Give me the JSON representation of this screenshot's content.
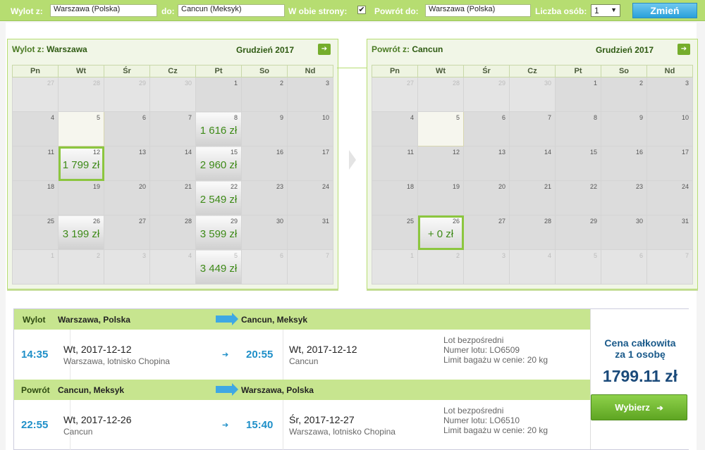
{
  "search": {
    "from_label": "Wylot z:",
    "from_value": "Warszawa (Polska)",
    "to_label": "do:",
    "to_value": "Cancun (Meksyk)",
    "roundtrip_label": "W obie strony:",
    "roundtrip_checked": "✔",
    "return_label": "Powrót do:",
    "return_value": "Warszawa (Polska)",
    "persons_label": "Liczba osób:",
    "persons_value": "1",
    "change_button": "Zmień"
  },
  "outbound_calendar": {
    "title_prefix": "Wylot z:",
    "title_city": "Warszawa",
    "month": "Grudzień 2017",
    "weekdays": [
      "Pn",
      "Wt",
      "Śr",
      "Cz",
      "Pt",
      "So",
      "Nd"
    ],
    "weeks": [
      [
        {
          "d": "27",
          "o": 1
        },
        {
          "d": "28",
          "o": 1
        },
        {
          "d": "29",
          "o": 1
        },
        {
          "d": "30",
          "o": 1
        },
        {
          "d": "1"
        },
        {
          "d": "2"
        },
        {
          "d": "3"
        }
      ],
      [
        {
          "d": "4"
        },
        {
          "d": "5",
          "s": 1
        },
        {
          "d": "6"
        },
        {
          "d": "7"
        },
        {
          "d": "8",
          "p": "1 616 zł"
        },
        {
          "d": "9"
        },
        {
          "d": "10"
        }
      ],
      [
        {
          "d": "11"
        },
        {
          "d": "12",
          "p": "1 799 zł",
          "sel": 1
        },
        {
          "d": "13"
        },
        {
          "d": "14"
        },
        {
          "d": "15",
          "p": "2 960 zł"
        },
        {
          "d": "16"
        },
        {
          "d": "17"
        }
      ],
      [
        {
          "d": "18"
        },
        {
          "d": "19"
        },
        {
          "d": "20"
        },
        {
          "d": "21"
        },
        {
          "d": "22",
          "p": "2 549 zł"
        },
        {
          "d": "23"
        },
        {
          "d": "24"
        }
      ],
      [
        {
          "d": "25"
        },
        {
          "d": "26",
          "p": "3 199 zł"
        },
        {
          "d": "27"
        },
        {
          "d": "28"
        },
        {
          "d": "29",
          "p": "3 599 zł"
        },
        {
          "d": "30"
        },
        {
          "d": "31"
        }
      ],
      [
        {
          "d": "1",
          "o": 1
        },
        {
          "d": "2",
          "o": 1
        },
        {
          "d": "3",
          "o": 1
        },
        {
          "d": "4",
          "o": 1
        },
        {
          "d": "5",
          "p": "3 449 zł",
          "o": 1
        },
        {
          "d": "6",
          "o": 1
        },
        {
          "d": "7",
          "o": 1
        }
      ]
    ]
  },
  "return_calendar": {
    "title_prefix": "Powrót z:",
    "title_city": "Cancun",
    "month": "Grudzień 2017",
    "weekdays": [
      "Pn",
      "Wt",
      "Śr",
      "Cz",
      "Pt",
      "So",
      "Nd"
    ],
    "weeks": [
      [
        {
          "d": "27",
          "o": 1
        },
        {
          "d": "28",
          "o": 1
        },
        {
          "d": "29",
          "o": 1
        },
        {
          "d": "30",
          "o": 1
        },
        {
          "d": "1"
        },
        {
          "d": "2"
        },
        {
          "d": "3"
        }
      ],
      [
        {
          "d": "4"
        },
        {
          "d": "5",
          "s": 1
        },
        {
          "d": "6"
        },
        {
          "d": "7"
        },
        {
          "d": "8"
        },
        {
          "d": "9"
        },
        {
          "d": "10"
        }
      ],
      [
        {
          "d": "11"
        },
        {
          "d": "12"
        },
        {
          "d": "13"
        },
        {
          "d": "14"
        },
        {
          "d": "15"
        },
        {
          "d": "16"
        },
        {
          "d": "17"
        }
      ],
      [
        {
          "d": "18"
        },
        {
          "d": "19"
        },
        {
          "d": "20"
        },
        {
          "d": "21"
        },
        {
          "d": "22"
        },
        {
          "d": "23"
        },
        {
          "d": "24"
        }
      ],
      [
        {
          "d": "25"
        },
        {
          "d": "26",
          "p": "+ 0 zł",
          "sel": 1
        },
        {
          "d": "27"
        },
        {
          "d": "28"
        },
        {
          "d": "29"
        },
        {
          "d": "30"
        },
        {
          "d": "31"
        }
      ],
      [
        {
          "d": "1",
          "o": 1
        },
        {
          "d": "2",
          "o": 1
        },
        {
          "d": "3",
          "o": 1
        },
        {
          "d": "4",
          "o": 1
        },
        {
          "d": "5",
          "o": 1
        },
        {
          "d": "6",
          "o": 1
        },
        {
          "d": "7",
          "o": 1
        }
      ]
    ]
  },
  "outbound_flight": {
    "label": "Wylot",
    "from": "Warszawa, Polska",
    "to": "Cancun, Meksyk",
    "dep_time": "14:35",
    "dep_date": "Wt, 2017-12-12",
    "dep_airport": "Warszawa, lotnisko Chopina",
    "arr_time": "20:55",
    "arr_date": "Wt, 2017-12-12",
    "arr_airport": "Cancun",
    "info1": "Lot bezpośredni",
    "info2": "Numer lotu: LO6509",
    "info3": "Limit bagażu w cenie: 20 kg"
  },
  "return_flight": {
    "label": "Powrót",
    "from": "Cancun, Meksyk",
    "to": "Warszawa, Polska",
    "dep_time": "22:55",
    "dep_date": "Wt, 2017-12-26",
    "dep_airport": "Cancun",
    "arr_time": "15:40",
    "arr_date": "Śr, 2017-12-27",
    "arr_airport": "Warszawa, lotnisko Chopina",
    "info1": "Lot bezpośredni",
    "info2": "Numer lotu: LO6510",
    "info3": "Limit bagażu w cenie: 20 kg"
  },
  "price": {
    "label_line1": "Cena całkowita",
    "label_line2": "za 1 osobę",
    "amount": "1799.11 zł",
    "select_button": "Wybierz",
    "select_arrow": "➔"
  },
  "colors": {
    "accent_green": "#b6dd71",
    "price_green": "#3e8a18",
    "time_blue": "#1e8fc8",
    "button_blue": "#2aa0db"
  }
}
